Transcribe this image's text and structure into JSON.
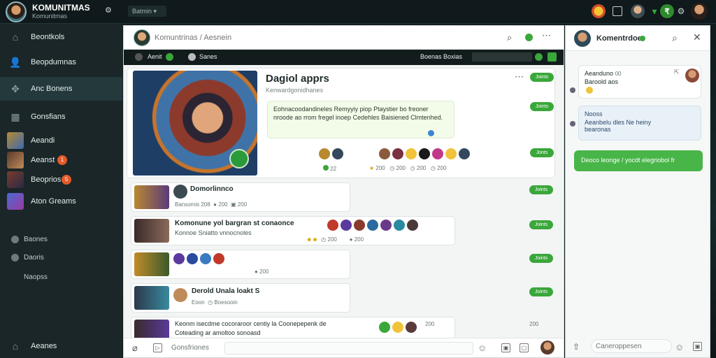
{
  "app": {
    "title": "KOMUNITMAS",
    "subtitle": "Komunitmas",
    "chip_label": "Batmin"
  },
  "sidebar": {
    "nav": [
      {
        "label": "Beontkols",
        "icon": "home-icon"
      },
      {
        "label": "Beopdumnas",
        "icon": "user-icon"
      },
      {
        "label": "Anc Bonens",
        "icon": "gamepad-icon"
      },
      {
        "label": "Gonsfians",
        "icon": "grid-icon"
      }
    ],
    "games": [
      {
        "label": "Aeandi",
        "badge": ""
      },
      {
        "label": "Aeanst",
        "badge": "1"
      },
      {
        "label": "Beoprios",
        "badge": "5"
      },
      {
        "label": "Aton Greams",
        "badge": ""
      }
    ],
    "sub": [
      {
        "label": "Baones"
      },
      {
        "label": "Daoris"
      },
      {
        "label": "Naopss"
      }
    ],
    "footer": {
      "label": "Aeanes"
    }
  },
  "main": {
    "search_placeholder": "Komuntrinas / Aesnein",
    "strip": {
      "left_label": "Aenit",
      "mid_label": "Sanes",
      "right_label": "Boenas Boxias"
    },
    "featured": {
      "title": "Dagiol apprs",
      "subtitle": "Kenwardgonidhanes",
      "body": "Eohnacoodandineles Remyyiy piop Ptaystier bo freoner nroode ao rrom fregel inoep Cedehles Baisiened Clmtenhed.",
      "count_a": "22",
      "count_b": "200",
      "count_c": "200",
      "count_d": "200",
      "count_e": "200",
      "pill": "Joints",
      "pill2": "Joints",
      "pill3": "Jonts"
    },
    "posts": [
      {
        "title": "Domorlinnco",
        "meta": "Bansomis 208",
        "stat": "200",
        "stat2": "200",
        "pill": "Joints"
      },
      {
        "title": "Komonune yol bargran st conaonce",
        "meta": "Konnoe Sniatto vnnocnoles",
        "stat": "200",
        "stat2": "200",
        "pill": "Joints"
      },
      {
        "title": "",
        "meta": "",
        "stat": "200",
        "stat2": "",
        "pill": "Joints"
      },
      {
        "title": "Derold Unala loakt S",
        "meta": "Eoon",
        "stat": "Boesooin",
        "stat2": "",
        "pill": "Joints"
      },
      {
        "title": "Keonm isecdme cocoraroor centiy la Coonepepenk de",
        "meta": "Coteading ar amoltoo sonoasd",
        "stat": "200",
        "stat2": "200",
        "pill": ""
      }
    ],
    "composer_placeholder": "Gonsfriones"
  },
  "right": {
    "name": "Komentrdoe",
    "messages": [
      {
        "sender": "Aeanduno",
        "time": "00",
        "text": "Baroold aos"
      },
      {
        "sender": "Nooss",
        "text": "Aeanbelu dles Ne heiny",
        "text2": "bearonas"
      },
      {
        "text": "Deoco leonge / yocdt elegriobol fr"
      }
    ],
    "input_placeholder": "Caneroppesen"
  },
  "colors": {
    "accent": "#3aa73a",
    "sidebar_bg": "#1a2628",
    "topbar_bg": "#10191b"
  }
}
